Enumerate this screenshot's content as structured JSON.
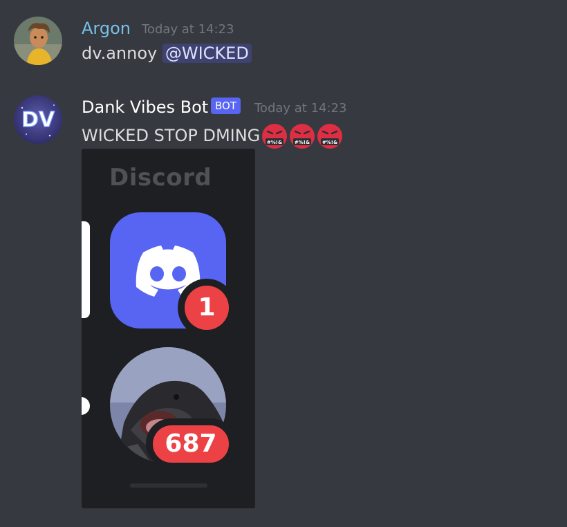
{
  "messages": [
    {
      "author": "Argon",
      "author_color": "#79c0e8",
      "timestamp": "Today at 14:23",
      "text": "dv.annoy",
      "mention": "@WICKED"
    },
    {
      "author": "Dank Vibes Bot",
      "author_color": "#ffffff",
      "bot_tag": "BOT",
      "timestamp": "Today at 14:23",
      "text": "WICKED STOP DMING",
      "emoji": [
        "face-with-symbols-on-mouth",
        "face-with-symbols-on-mouth",
        "face-with-symbols-on-mouth"
      ],
      "avatar_text": "DV",
      "attachment": {
        "header": "Discord",
        "app_badge": "1",
        "server_badge": "687"
      }
    }
  ]
}
